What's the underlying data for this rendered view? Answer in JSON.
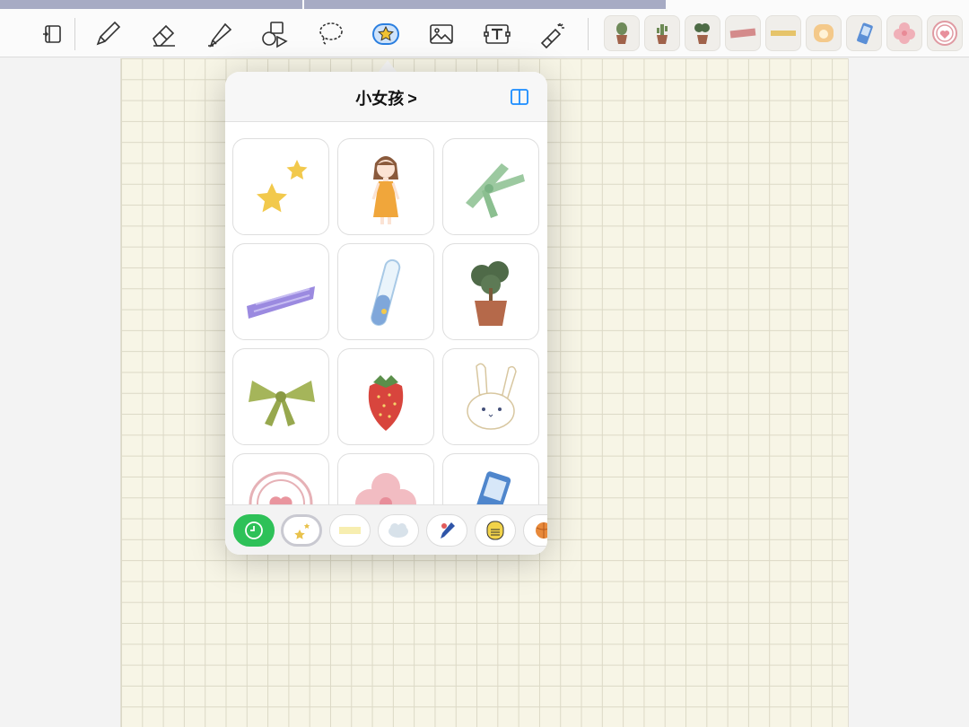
{
  "toolbar": {
    "tools": [
      {
        "name": "page-layout-icon"
      },
      {
        "name": "pen-icon"
      },
      {
        "name": "eraser-icon"
      },
      {
        "name": "highlighter-icon"
      },
      {
        "name": "shapes-icon"
      },
      {
        "name": "lasso-icon"
      },
      {
        "name": "sticker-icon",
        "active": true
      },
      {
        "name": "image-icon"
      },
      {
        "name": "text-icon",
        "label": "T"
      },
      {
        "name": "laser-pointer-icon"
      }
    ],
    "recent_stickers": [
      {
        "name": "potted-plant-sticker"
      },
      {
        "name": "cactus-sticker"
      },
      {
        "name": "bonsai-sticker"
      },
      {
        "name": "pink-tape-sticker"
      },
      {
        "name": "yellow-tape-sticker"
      },
      {
        "name": "toast-sticker"
      },
      {
        "name": "blue-phone-sticker"
      },
      {
        "name": "pink-flower-sticker"
      },
      {
        "name": "heart-badge-sticker"
      }
    ]
  },
  "sticker_panel": {
    "title": "小女孩",
    "chevron": ">",
    "stickers": [
      {
        "name": "stars-sticker"
      },
      {
        "name": "girl-sticker"
      },
      {
        "name": "green-ribbon-sticker"
      },
      {
        "name": "purple-tape-sticker"
      },
      {
        "name": "test-tube-sticker"
      },
      {
        "name": "potted-tree-sticker"
      },
      {
        "name": "green-bow-sticker"
      },
      {
        "name": "strawberry-sticker"
      },
      {
        "name": "bunny-sticker"
      },
      {
        "name": "heart-badge-sticker"
      },
      {
        "name": "pink-flower-sticker"
      },
      {
        "name": "blue-phone-sticker"
      }
    ],
    "categories": [
      {
        "name": "recent-clock-icon",
        "active": true
      },
      {
        "name": "stars-category"
      },
      {
        "name": "tape-category"
      },
      {
        "name": "cloud-category"
      },
      {
        "name": "pen-category"
      },
      {
        "name": "badge-category"
      },
      {
        "name": "ball-category"
      }
    ]
  },
  "colors": {
    "accent_blue": "#1a8cff",
    "active_green": "#2ec158",
    "paper": "#f7f5e6",
    "grid_line": "#dcd9c6"
  }
}
